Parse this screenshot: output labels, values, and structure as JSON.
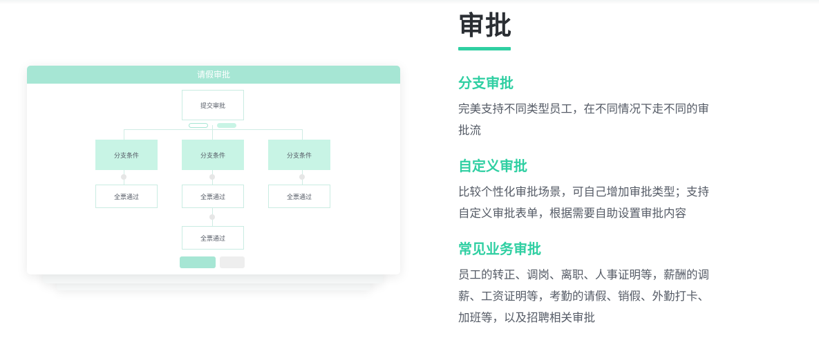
{
  "mockup": {
    "header": "请假审批",
    "submit_node": "提交审批",
    "branches": [
      {
        "condition": "分支条件",
        "result": "全票通过"
      },
      {
        "condition": "分支条件",
        "result": "全票通过"
      },
      {
        "condition": "分支条件",
        "result": "全票通过"
      }
    ],
    "final_node": "全票通过"
  },
  "section": {
    "title": "审批",
    "features": [
      {
        "title": "分支审批",
        "desc": [
          "完美支持不同类型员工，在不同情况下走不同的审",
          "批流"
        ]
      },
      {
        "title": "自定义审批",
        "desc": [
          "比较个性化审批场景，可自己增加审批类型；支持",
          "自定义审批表单，根据需要自助设置审批内容"
        ]
      },
      {
        "title": "常见业务审批",
        "desc": [
          "员工的转正、调岗、离职、人事证明等，薪酬的调",
          "薪、工资证明等，考勤的请假、销假、外勤打卡、",
          "加班等，以及招聘相关审批"
        ]
      }
    ]
  },
  "colors": {
    "accent": "#2fcfa2",
    "mock_header": "#a6e6d4",
    "mock_condition": "#c8f4e5",
    "heading_text": "#2a2e33",
    "body_text": "#555b66"
  }
}
